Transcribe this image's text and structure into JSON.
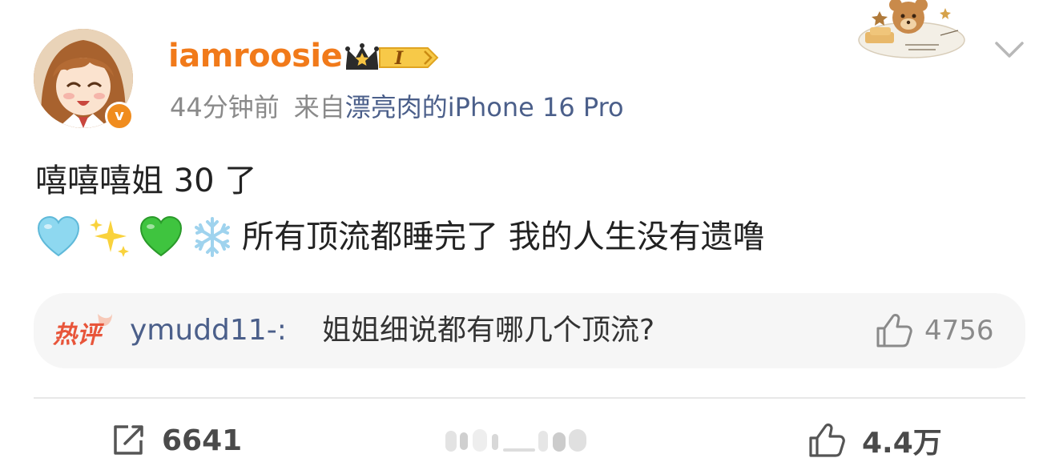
{
  "post": {
    "author": {
      "username": "iamroosie",
      "verified_badge_text": "v",
      "member_level": "I",
      "avatar_alt": "avatar"
    },
    "meta": {
      "time": "44分钟前",
      "source_prefix": "来自",
      "source_name": "漂亮肉的",
      "source_device": "iPhone 16 Pro"
    },
    "content": {
      "line1": "嘻嘻嘻姐 30 了",
      "line2_emojis": [
        "light-blue-heart-icon",
        "sparkles-icon",
        "green-heart-icon",
        "snowflake-icon"
      ],
      "line2_text": "所有顶流都睡完了 我的人生没有遗噜"
    },
    "hot_comment": {
      "tag": "热评",
      "author": "ymudd11-:",
      "text": "姐姐细说都有哪几个顶流?",
      "likes": "4756"
    },
    "footer": {
      "repost_count": "6641",
      "like_count": "4.4万"
    },
    "colors": {
      "username": "#f17a1a",
      "link": "#4b5f8a",
      "meta": "#8a8a8a",
      "hot_tag": "#e8553a"
    }
  }
}
